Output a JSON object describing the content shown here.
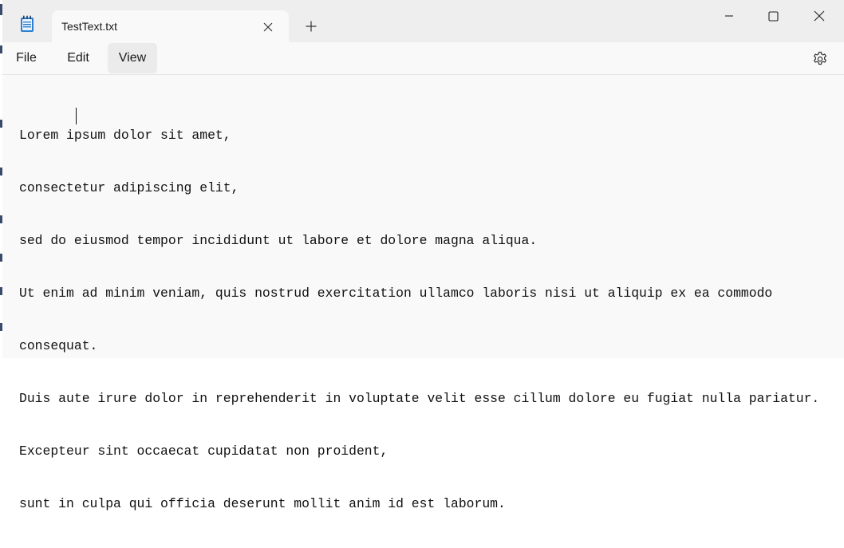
{
  "window": {
    "tab_title": "TestText.txt",
    "app_icon": "notepad-icon",
    "new_tab_icon": "plus-icon",
    "close_tab_icon": "close-icon",
    "controls": [
      "minimize-icon",
      "maximize-icon",
      "close-icon"
    ]
  },
  "menu": {
    "file": "File",
    "edit": "Edit",
    "view": "View",
    "settings_icon": "gear-icon"
  },
  "editor": {
    "lines": [
      "Lorem ipsum dolor sit amet,",
      "consectetur adipiscing elit,",
      "sed do eiusmod tempor incididunt ut labore et dolore magna aliqua.",
      "Ut enim ad minim veniam, quis nostrud exercitation ullamco laboris nisi ut aliquip ex ea commodo",
      "consequat.",
      "Duis aute irure dolor in reprehenderit in voluptate velit esse cillum dolore eu fugiat nulla pariatur.",
      "Excepteur sint occaecat cupidatat non proident,",
      "sunt in culpa qui officia deserunt mollit anim id est laborum."
    ]
  },
  "colors": {
    "titlebar": "#eeeeee",
    "surface": "#f9f9f9",
    "hover": "#ebebeb",
    "text": "#111111"
  }
}
